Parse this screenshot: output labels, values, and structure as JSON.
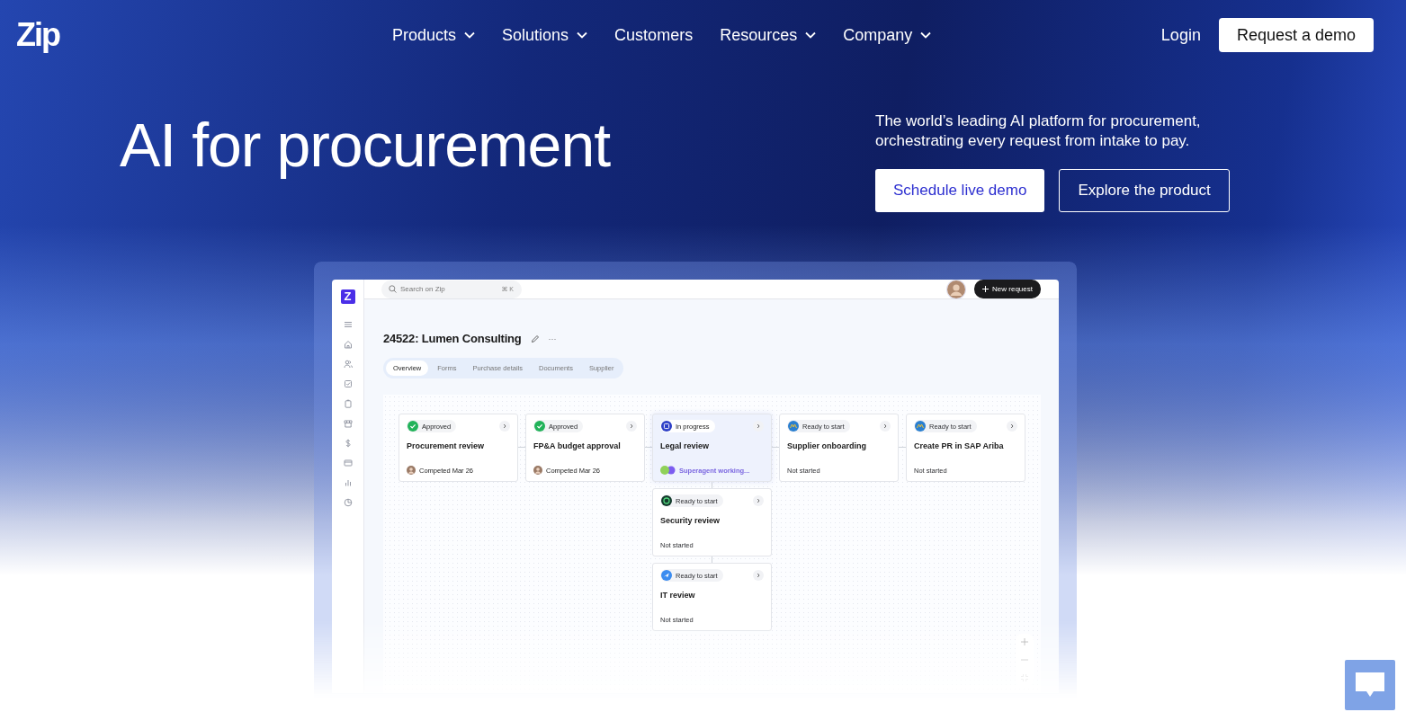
{
  "nav": {
    "logo": "Zip",
    "links": [
      {
        "label": "Products",
        "dropdown": true
      },
      {
        "label": "Solutions",
        "dropdown": true
      },
      {
        "label": "Customers",
        "dropdown": false
      },
      {
        "label": "Resources",
        "dropdown": true
      },
      {
        "label": "Company",
        "dropdown": true
      }
    ],
    "login": "Login",
    "cta": "Request a demo"
  },
  "hero": {
    "title": "AI for procurement",
    "tagline": "The world’s leading AI platform for procurement, orchestrating every request from intake to pay.",
    "buttons": [
      {
        "label": "Schedule live demo",
        "kind": "primary"
      },
      {
        "label": "Explore the product",
        "kind": "outline"
      }
    ]
  },
  "app": {
    "logo": "Z",
    "search": {
      "placeholder": "Search on Zip",
      "shortcut": "⌘ K"
    },
    "new_request": "New request",
    "request_title": "24522: Lumen Consulting",
    "more": "···",
    "tabs": [
      {
        "label": "Overview",
        "selected": true
      },
      {
        "label": "Forms",
        "selected": false
      },
      {
        "label": "Purchase details",
        "selected": false
      },
      {
        "label": "Documents",
        "selected": false
      },
      {
        "label": "Supplier",
        "selected": false
      }
    ],
    "stages": [
      {
        "status": {
          "text": "Approved",
          "kind": "approved"
        },
        "badge": {
          "kind": "check"
        },
        "title": "Procurement review",
        "footer": {
          "text": "Competed Mar 26",
          "kind": "completed"
        }
      },
      {
        "status": {
          "text": "Approved",
          "kind": "approved"
        },
        "badge": {
          "kind": "check"
        },
        "title": "FP&A budget approval",
        "footer": {
          "text": "Competed Mar 26",
          "kind": "completed"
        }
      },
      {
        "status": {
          "text": "In progress",
          "kind": "in_progress"
        },
        "badge": {
          "kind": "square"
        },
        "title": "Legal review",
        "footer": {
          "text": "Superagent working...",
          "kind": "agent"
        },
        "children": [
          {
            "status": {
              "text": "Ready to start",
              "kind": "ready"
            },
            "badge": {
              "kind": "ring"
            },
            "title": "Security review",
            "footer": {
              "text": "Not started",
              "kind": "plain"
            }
          },
          {
            "status": {
              "text": "Ready to start",
              "kind": "ready"
            },
            "badge": {
              "kind": "plane"
            },
            "title": "IT review",
            "footer": {
              "text": "Not started",
              "kind": "plain"
            }
          }
        ]
      },
      {
        "status": {
          "text": "Ready to start",
          "kind": "ready"
        },
        "badge": {
          "kind": "peaks"
        },
        "title": "Supplier onboarding",
        "footer": {
          "text": "Not started",
          "kind": "plain"
        }
      },
      {
        "status": {
          "text": "Ready to start",
          "kind": "ready"
        },
        "badge": {
          "kind": "peaks"
        },
        "title": "Create PR in SAP Ariba",
        "footer": {
          "text": "Not started",
          "kind": "plain"
        }
      }
    ]
  }
}
